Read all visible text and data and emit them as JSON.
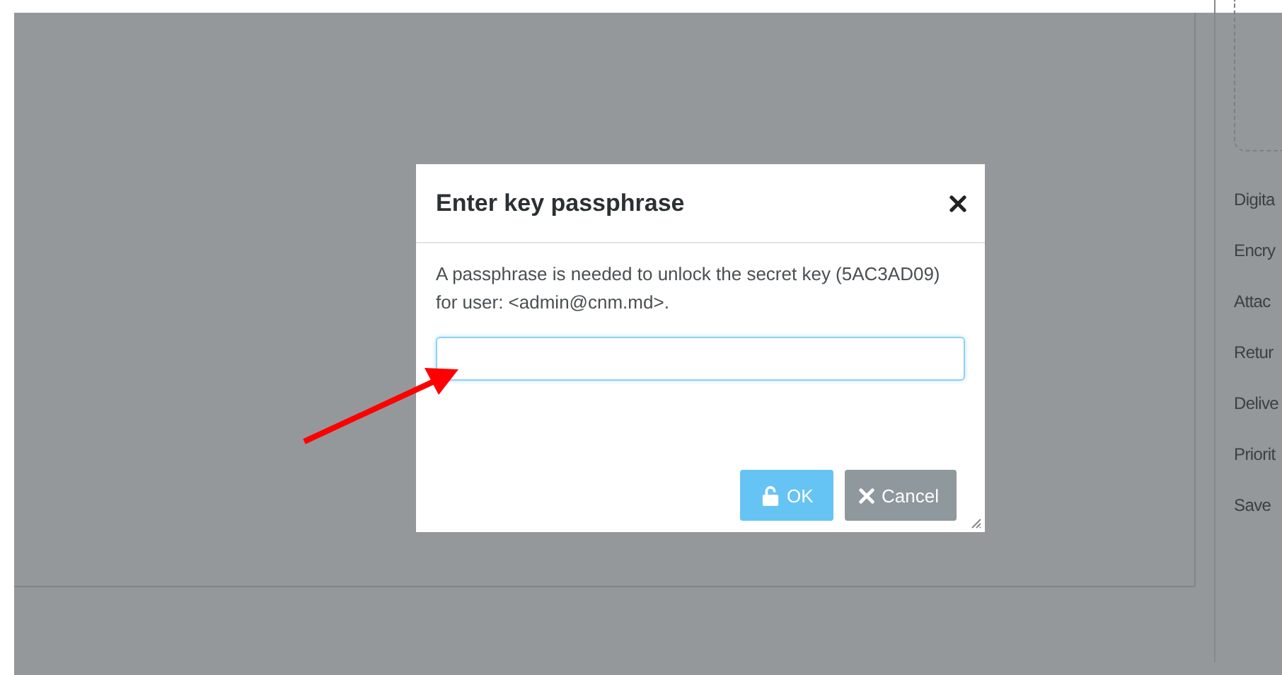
{
  "sidebar": {
    "labels": [
      "Digita",
      "Encry",
      "Attac",
      "Retur",
      "Delive",
      "Priorit",
      "Save"
    ]
  },
  "dialog": {
    "title": "Enter key passphrase",
    "message": "A passphrase is needed to unlock the secret key (5AC3AD09) for user: <admin@cnm.md>.",
    "buttons": [
      {
        "label": "OK",
        "kind": "primary"
      },
      {
        "label": "Cancel",
        "kind": "secondary"
      }
    ]
  }
}
